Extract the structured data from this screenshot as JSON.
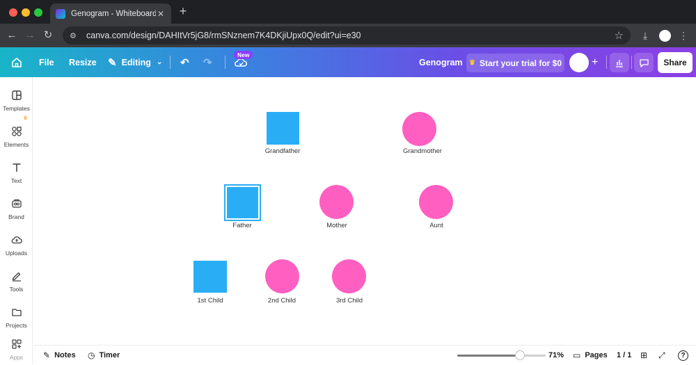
{
  "browser": {
    "tab_title": "Genogram - Whiteboard",
    "tab_close": "✕",
    "new_tab": "+",
    "url": "canva.com/design/DAHItVr5jG8/rmSNznem7K4DKjiUpx0Q/edit?ui=e30"
  },
  "toolbar": {
    "file_label": "File",
    "resize_label": "Resize",
    "editing_label": "Editing",
    "new_badge": "New",
    "doc_title": "Genogram",
    "trial_label": "Start your trial for $0",
    "share_label": "Share"
  },
  "sidebar": {
    "items": [
      {
        "label": "Templates",
        "icon": "templates-icon"
      },
      {
        "label": "Elements",
        "icon": "elements-icon"
      },
      {
        "label": "Text",
        "icon": "text-icon"
      },
      {
        "label": "Brand",
        "icon": "brand-icon"
      },
      {
        "label": "Uploads",
        "icon": "uploads-icon"
      },
      {
        "label": "Tools",
        "icon": "tools-icon"
      },
      {
        "label": "Projects",
        "icon": "projects-icon"
      },
      {
        "label": "Apps",
        "icon": "apps-icon"
      }
    ]
  },
  "genogram": {
    "nodes": [
      {
        "label": "Grandfather",
        "shape": "square",
        "gender": "male"
      },
      {
        "label": "Grandmother",
        "shape": "circle",
        "gender": "female"
      },
      {
        "label": "Father",
        "shape": "square",
        "gender": "male",
        "selected": true
      },
      {
        "label": "Mother",
        "shape": "circle",
        "gender": "female"
      },
      {
        "label": "Aunt",
        "shape": "circle",
        "gender": "female"
      },
      {
        "label": "1st Child",
        "shape": "square",
        "gender": "male"
      },
      {
        "label": "2nd Child",
        "shape": "circle",
        "gender": "female"
      },
      {
        "label": "3rd Child",
        "shape": "circle",
        "gender": "female"
      }
    ],
    "colors": {
      "male": "#29aef6",
      "female": "#fe5fc1"
    }
  },
  "bottom": {
    "notes_label": "Notes",
    "timer_label": "Timer",
    "zoom": "71%",
    "zoom_fraction": 0.71,
    "pages_label": "Pages",
    "page_indicator": "1 / 1",
    "help": "?"
  },
  "colors": {
    "accent": "#8b3dff",
    "gradient_start": "#19b5c8",
    "gradient_end": "#8b3fe4"
  }
}
